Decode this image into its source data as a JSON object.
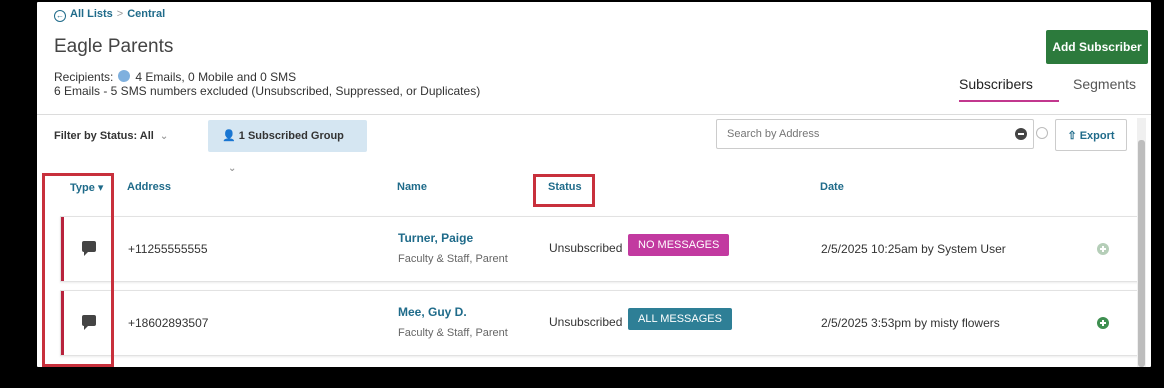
{
  "breadcrumb": {
    "back_icon": "←",
    "back_label": "All Lists",
    "separator": ">",
    "current": "Central"
  },
  "page": {
    "title": "Eagle Parents"
  },
  "recipients": {
    "label": "Recipients:",
    "summary": "4 Emails, 0 Mobile and 0 SMS",
    "excluded": "6 Emails - 5 SMS numbers excluded (Unsubscribed, Suppressed, or Duplicates)"
  },
  "actions": {
    "add_subscriber": "Add Subscriber",
    "export": "Export",
    "export_icon": "⇧"
  },
  "tabs": [
    {
      "label": "Subscribers",
      "active": true
    },
    {
      "label": "Segments",
      "active": false
    }
  ],
  "filters": {
    "status_label": "Filter by Status: All",
    "group_label": "1 Subscribed Group",
    "chevron": "⌄",
    "group_icon": "👤"
  },
  "search": {
    "placeholder": "Search by Address"
  },
  "table": {
    "columns": {
      "type": "Type ▾",
      "address": "Address",
      "name": "Name",
      "status": "Status",
      "date": "Date"
    },
    "rows": [
      {
        "address": "+11255555555",
        "name": "Turner, Paige",
        "groups": "Faculty & Staff, Parent",
        "status": "Unsubscribed",
        "badge": "NO MESSAGES",
        "badge_color": "#c23aa0",
        "date": "2/5/2025 10:25am by System User",
        "plus_color": "#b5ceb8"
      },
      {
        "address": "+18602893507",
        "name": "Mee, Guy D.",
        "groups": "Faculty & Staff, Parent",
        "status": "Unsubscribed",
        "badge": "ALL MESSAGES",
        "badge_color": "#2e7f96",
        "date": "2/5/2025 3:53pm by misty flowers",
        "plus_color": "#3e8f50"
      }
    ]
  },
  "colors": {
    "accent": "#1f6b8a",
    "primary_button": "#2c7a3c",
    "annotation": "#c8303c",
    "active_tab": "#c2378e"
  }
}
